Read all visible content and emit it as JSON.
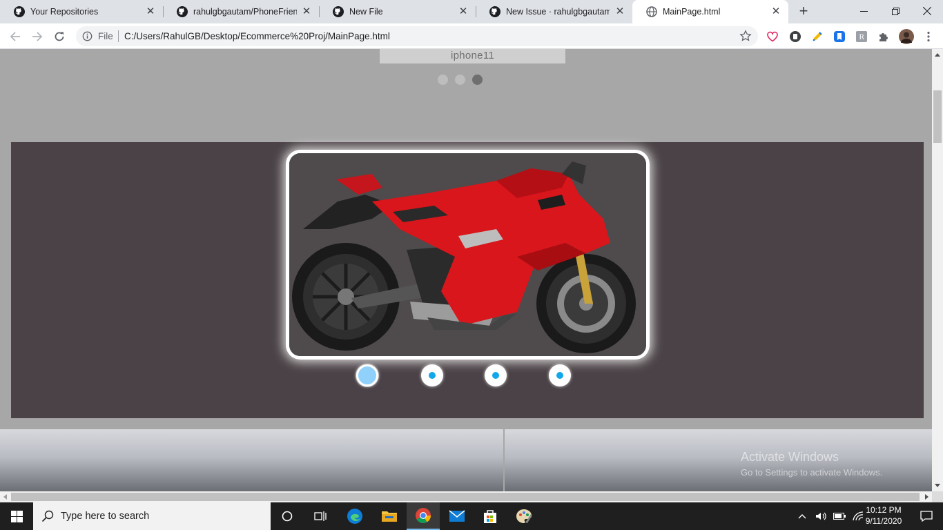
{
  "browser": {
    "tabs": [
      {
        "title": "Your Repositories"
      },
      {
        "title": "rahulgbgautam/PhoneFriend"
      },
      {
        "title": "New File"
      },
      {
        "title": "New Issue · rahulgbgautam/Ec"
      },
      {
        "title": "MainPage.html",
        "active": true
      }
    ],
    "address": {
      "scheme_label": "File",
      "url": "C:/Users/RahulGB/Desktop/Ecommerce%20Proj/MainPage.html"
    }
  },
  "page": {
    "top_slider": {
      "caption": "iphone11",
      "dot_count": 3,
      "active_dot": 3
    },
    "bike_slider": {
      "image_subject": "red-ducati-sport-motorcycle",
      "radio_count": 4,
      "selected_radio": 1
    },
    "watermark": {
      "title": "Activate Windows",
      "subtitle": "Go to Settings to activate Windows."
    }
  },
  "taskbar": {
    "search_placeholder": "Type here to search",
    "clock_time": "10:12 PM",
    "clock_date": "9/11/2020"
  },
  "colors": {
    "page_bg": "#a7a7a7",
    "slider_bg": "#4a4246",
    "radio_dot": "#11a7e8",
    "radio_selected": "#8fd1fb",
    "bike_red": "#d9161c"
  }
}
